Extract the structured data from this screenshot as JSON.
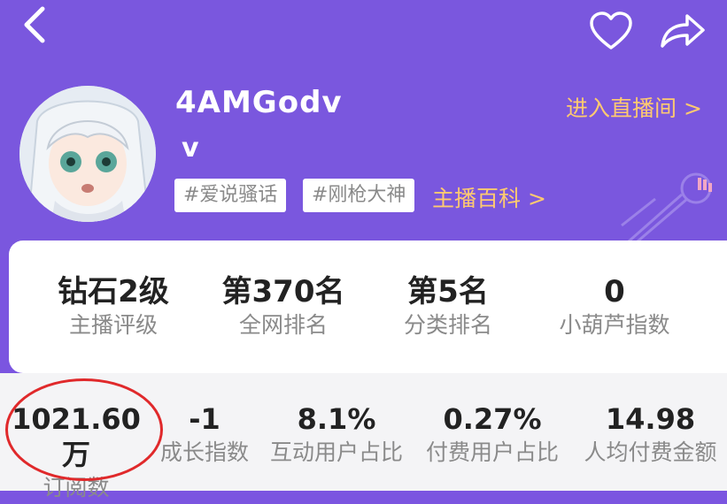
{
  "header": {
    "streamer_name": "4AMGodv",
    "level_text": "v",
    "tags": [
      "#爱说骚话",
      "#刚枪大神"
    ],
    "wiki_link": "主播百科 >",
    "live_link": "进入直播间 >"
  },
  "stats_top": [
    {
      "value": "钻石2级",
      "label": "主播评级"
    },
    {
      "value": "第370名",
      "label": "全网排名"
    },
    {
      "value": "第5名",
      "label": "分类排名"
    },
    {
      "value": "0",
      "label": "小葫芦指数"
    }
  ],
  "stats_bottom": [
    {
      "value": "1021.60万",
      "label": "订阅数"
    },
    {
      "value": "-1",
      "label": "成长指数"
    },
    {
      "value": "8.1%",
      "label": "互动用户占比"
    },
    {
      "value": "0.27%",
      "label": "付费用户占比"
    },
    {
      "value": "14.98",
      "label": "人均付费金额"
    }
  ],
  "icons": {
    "back": "chevron-left-icon",
    "favorite": "heart-icon",
    "share": "share-icon",
    "decor": "microphone-icon"
  },
  "colors": {
    "header_bg": "#7a57de",
    "accent": "#ffca70",
    "highlight": "#e0292b"
  }
}
